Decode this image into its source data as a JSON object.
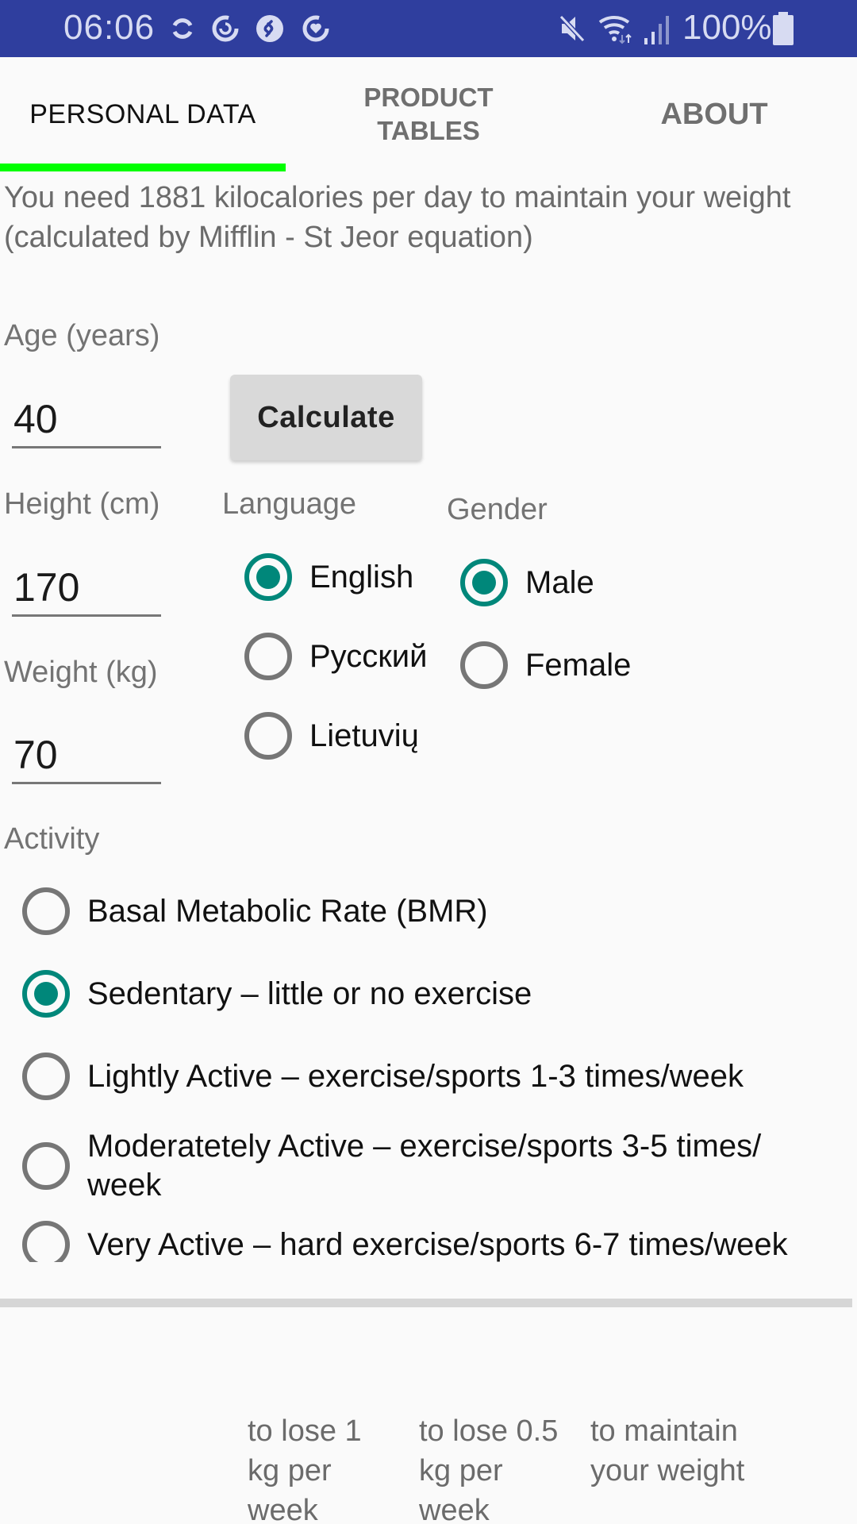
{
  "status_bar": {
    "time": "06:06",
    "left_icons": [
      "sync-icon",
      "refresh-circle-icon",
      "shazam-icon",
      "heart-circle-icon"
    ],
    "right_icons": [
      "mute-icon",
      "wifi-icon",
      "signal-icon",
      "battery-icon"
    ],
    "battery": "100%"
  },
  "tabs": [
    {
      "label": "PERSONAL DATA",
      "active": true
    },
    {
      "label": "PRODUCT TABLES",
      "active": false
    },
    {
      "label": "ABOUT",
      "active": false
    }
  ],
  "accent_color": "#00ff00",
  "radio_color": "#00877a",
  "summary": {
    "line1": "You need 1881 kilocalories per day to maintain your weight",
    "line2": "(calculated by Mifflin - St Jeor equation)"
  },
  "form": {
    "age": {
      "label": "Age (years)",
      "value": "40"
    },
    "height": {
      "label": "Height (cm)",
      "value": "170"
    },
    "weight": {
      "label": "Weight (kg)",
      "value": "70"
    },
    "calculate_label": "Calculate",
    "language": {
      "label": "Language",
      "options": [
        {
          "label": "English",
          "checked": true
        },
        {
          "label": "Русский",
          "checked": false
        },
        {
          "label": "Lietuvių",
          "checked": false
        }
      ]
    },
    "gender": {
      "label": "Gender",
      "options": [
        {
          "label": "Male",
          "checked": true
        },
        {
          "label": "Female",
          "checked": false
        }
      ]
    },
    "activity": {
      "label": "Activity",
      "options": [
        {
          "label": "Basal Metabolic Rate (BMR)",
          "checked": false
        },
        {
          "label": "Sedentary – little or no exercise",
          "checked": true
        },
        {
          "label": "Lightly Active – exercise/sports 1-3 times/week",
          "checked": false
        },
        {
          "label": "Moderatetely Active – exercise/sports 3-5 times/ week",
          "checked": false
        },
        {
          "label": "Very Active – hard exercise/sports 6-7 times/week",
          "checked": false
        }
      ]
    }
  },
  "goals_table": {
    "headers": [
      "to lose 1 kg per week",
      "to lose 0.5 kg per week",
      "to maintain your weight"
    ]
  }
}
